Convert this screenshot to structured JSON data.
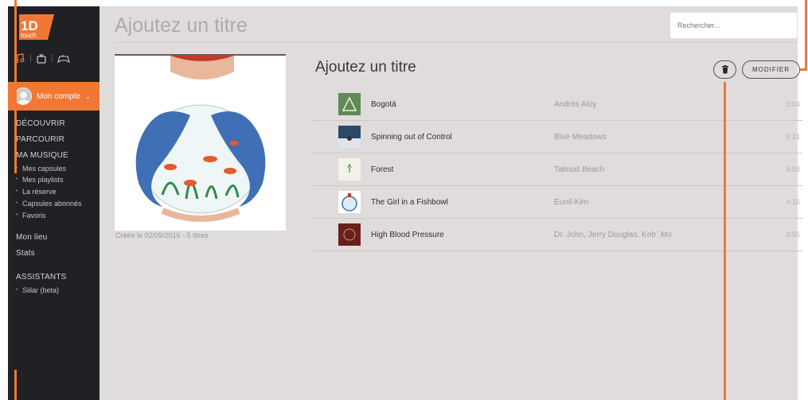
{
  "sidebar": {
    "logo_text": "1D",
    "logo_sub": "touch",
    "account_label": "Mon compte",
    "nav": {
      "decouvrir": "DÉCOUVRIR",
      "parcourir": "PARCOURIR",
      "ma_musique": "MA MUSIQUE",
      "mes_capsules": "Mes capsules",
      "mes_playlists": "Mes playlists",
      "la_reserve": "La réserve",
      "capsules_abonnes": "Capsules abonnés",
      "favoris": "Favoris",
      "mon_lieu": "Mon lieu",
      "stats": "Stats",
      "assistants": "ASSISTANTS",
      "siilar": "Siilar (beta)"
    }
  },
  "header": {
    "title": "Ajoutez un titre",
    "search_placeholder": "Rechercher..."
  },
  "playlist": {
    "title": "Ajoutez un titre",
    "created": "Créée le 02/09/2016 - 5 titres",
    "modify_label": "MODIFIER",
    "tracks": [
      {
        "title": "Bogotá",
        "artist": "Andrés Aloy",
        "duration": "3:04"
      },
      {
        "title": "Spinning out of Control",
        "artist": "Blue Meadows",
        "duration": "5:21"
      },
      {
        "title": "Forest",
        "artist": "Talmud Beach",
        "duration": "4:58"
      },
      {
        "title": "The Girl in a Fishbowl",
        "artist": "Eunil-Kim",
        "duration": "4:16"
      },
      {
        "title": "High Blood Pressure",
        "artist": "Dr. John, Jerry Douglas, Keb´ Mo",
        "duration": "3:55"
      }
    ]
  },
  "colors": {
    "accent": "#f07834",
    "sidebar_bg": "#1f2124",
    "main_bg": "#e0dcdc"
  }
}
